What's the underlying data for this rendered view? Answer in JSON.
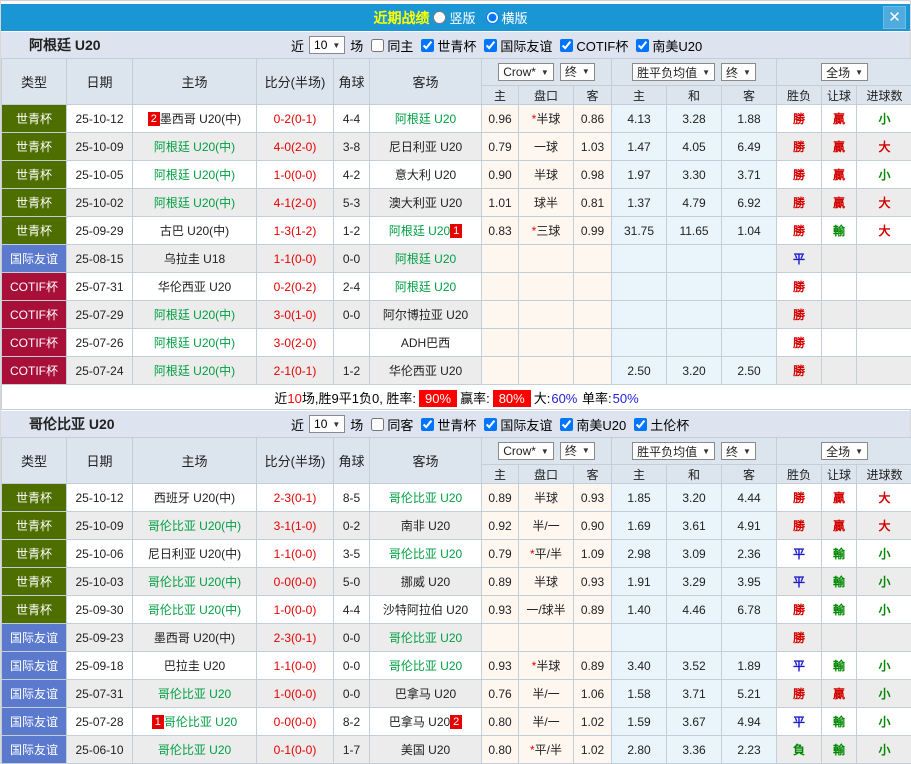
{
  "colors": {
    "titlebar_bg": "#1b96d5",
    "title_text": "#ffff00",
    "team_green": "#00a042",
    "score_red": "#e60000",
    "result_red": "#d40000",
    "result_green": "#008800",
    "result_blue": "#1a1acc",
    "pct_badge_bg": "#ff0000",
    "pct_blue": "#2222dd",
    "type_colors": {
      "世青杯": "#4e6e00",
      "国际友谊": "#5b7ace",
      "COTIF杯": "#a80f39"
    }
  },
  "titlebar": {
    "title": "近期战绩",
    "layout_options": [
      {
        "label": "竖版",
        "selected": false
      },
      {
        "label": "横版",
        "selected": true
      }
    ],
    "close_label": "✕"
  },
  "table_header": {
    "type": "类型",
    "date": "日期",
    "home": "主场",
    "score": "比分(半场)",
    "corner": "角球",
    "away": "客场",
    "odds_select": "Crow*",
    "final_select": "终",
    "avg_select": "胜平负均值",
    "final_select2": "终",
    "scope_select": "全场",
    "sub": [
      "主",
      "盘口",
      "客",
      "主",
      "和",
      "客",
      "胜负",
      "让球",
      "进球数"
    ]
  },
  "sections": [
    {
      "team": "阿根廷 U20",
      "filter": {
        "near_label": "近",
        "count": "10",
        "games_label": "场",
        "same_label": "同主",
        "same_checked": false,
        "competitions": [
          {
            "label": "世青杯",
            "checked": true
          },
          {
            "label": "国际友谊",
            "checked": true
          },
          {
            "label": "COTIF杯",
            "checked": true
          },
          {
            "label": "南美U20",
            "checked": true
          }
        ]
      },
      "rows": [
        {
          "type": "世青杯",
          "date": "25-10-12",
          "homeBadge": "2",
          "home": "墨西哥 U20(中)",
          "homeGreen": false,
          "score": "0-2(0-1)",
          "corner": "4-4",
          "away": "阿根廷 U20",
          "awayGreen": true,
          "awayBadge": "",
          "crow": [
            "0.96",
            "*半球",
            "0.86"
          ],
          "avg": [
            "4.13",
            "3.28",
            "1.88"
          ],
          "res": [
            "勝",
            "贏",
            "小"
          ]
        },
        {
          "type": "世青杯",
          "date": "25-10-09",
          "homeBadge": "",
          "home": "阿根廷 U20(中)",
          "homeGreen": true,
          "score": "4-0(2-0)",
          "corner": "3-8",
          "away": "尼日利亚 U20",
          "awayGreen": false,
          "awayBadge": "",
          "crow": [
            "0.79",
            "一球",
            "1.03"
          ],
          "avg": [
            "1.47",
            "4.05",
            "6.49"
          ],
          "res": [
            "勝",
            "贏",
            "大"
          ]
        },
        {
          "type": "世青杯",
          "date": "25-10-05",
          "homeBadge": "",
          "home": "阿根廷 U20(中)",
          "homeGreen": true,
          "score": "1-0(0-0)",
          "corner": "4-2",
          "away": "意大利 U20",
          "awayGreen": false,
          "awayBadge": "",
          "crow": [
            "0.90",
            "半球",
            "0.98"
          ],
          "avg": [
            "1.97",
            "3.30",
            "3.71"
          ],
          "res": [
            "勝",
            "贏",
            "小"
          ]
        },
        {
          "type": "世青杯",
          "date": "25-10-02",
          "homeBadge": "",
          "home": "阿根廷 U20(中)",
          "homeGreen": true,
          "score": "4-1(2-0)",
          "corner": "5-3",
          "away": "澳大利亚 U20",
          "awayGreen": false,
          "awayBadge": "",
          "crow": [
            "1.01",
            "球半",
            "0.81"
          ],
          "avg": [
            "1.37",
            "4.79",
            "6.92"
          ],
          "res": [
            "勝",
            "贏",
            "大"
          ]
        },
        {
          "type": "世青杯",
          "date": "25-09-29",
          "homeBadge": "",
          "home": "古巴 U20(中)",
          "homeGreen": false,
          "score": "1-3(1-2)",
          "corner": "1-2",
          "away": "阿根廷 U20",
          "awayGreen": true,
          "awayBadge": "1",
          "crow": [
            "0.83",
            "*三球",
            "0.99"
          ],
          "avg": [
            "31.75",
            "11.65",
            "1.04"
          ],
          "res": [
            "勝",
            "輸",
            "大"
          ]
        },
        {
          "type": "国际友谊",
          "date": "25-08-15",
          "homeBadge": "",
          "home": "乌拉圭 U18",
          "homeGreen": false,
          "score": "1-1(0-0)",
          "corner": "0-0",
          "away": "阿根廷 U20",
          "awayGreen": true,
          "awayBadge": "",
          "crow": [
            "",
            "",
            ""
          ],
          "avg": [
            "",
            "",
            ""
          ],
          "res": [
            "平",
            "",
            ""
          ]
        },
        {
          "type": "COTIF杯",
          "date": "25-07-31",
          "homeBadge": "",
          "home": "华伦西亚 U20",
          "homeGreen": false,
          "score": "0-2(0-2)",
          "corner": "2-4",
          "away": "阿根廷 U20",
          "awayGreen": true,
          "awayBadge": "",
          "crow": [
            "",
            "",
            ""
          ],
          "avg": [
            "",
            "",
            ""
          ],
          "res": [
            "勝",
            "",
            ""
          ]
        },
        {
          "type": "COTIF杯",
          "date": "25-07-29",
          "homeBadge": "",
          "home": "阿根廷 U20(中)",
          "homeGreen": true,
          "score": "3-0(1-0)",
          "corner": "0-0",
          "away": "阿尔博拉亚 U20",
          "awayGreen": false,
          "awayBadge": "",
          "crow": [
            "",
            "",
            ""
          ],
          "avg": [
            "",
            "",
            ""
          ],
          "res": [
            "勝",
            "",
            ""
          ]
        },
        {
          "type": "COTIF杯",
          "date": "25-07-26",
          "homeBadge": "",
          "home": "阿根廷 U20(中)",
          "homeGreen": true,
          "score": "3-0(2-0)",
          "corner": "",
          "away": "ADH巴西",
          "awayGreen": false,
          "awayBadge": "",
          "crow": [
            "",
            "",
            ""
          ],
          "avg": [
            "",
            "",
            ""
          ],
          "res": [
            "勝",
            "",
            ""
          ]
        },
        {
          "type": "COTIF杯",
          "date": "25-07-24",
          "homeBadge": "",
          "home": "阿根廷 U20(中)",
          "homeGreen": true,
          "score": "2-1(0-1)",
          "corner": "1-2",
          "away": "华伦西亚 U20",
          "awayGreen": false,
          "awayBadge": "",
          "crow": [
            "",
            "",
            ""
          ],
          "avg": [
            "2.50",
            "3.20",
            "2.50"
          ],
          "res": [
            "勝",
            "",
            ""
          ]
        }
      ],
      "summary": [
        {
          "t": "近",
          "s": "k"
        },
        {
          "t": "10",
          "s": "red"
        },
        {
          "t": "场,胜9平1负0, 胜率:",
          "s": "k"
        },
        {
          "t": "90%",
          "s": "redbg"
        },
        {
          "t": "赢率:",
          "s": "k"
        },
        {
          "t": "80%",
          "s": "redbg"
        },
        {
          "t": "大:",
          "s": "k"
        },
        {
          "t": "60%",
          "s": "blue"
        },
        {
          "t": " 单率:",
          "s": "k"
        },
        {
          "t": "50%",
          "s": "blue"
        }
      ]
    },
    {
      "team": "哥伦比亚 U20",
      "filter": {
        "near_label": "近",
        "count": "10",
        "games_label": "场",
        "same_label": "同客",
        "same_checked": false,
        "competitions": [
          {
            "label": "世青杯",
            "checked": true
          },
          {
            "label": "国际友谊",
            "checked": true
          },
          {
            "label": "南美U20",
            "checked": true
          },
          {
            "label": "土伦杯",
            "checked": true
          }
        ]
      },
      "rows": [
        {
          "type": "世青杯",
          "date": "25-10-12",
          "homeBadge": "",
          "home": "西班牙 U20(中)",
          "homeGreen": false,
          "score": "2-3(0-1)",
          "corner": "8-5",
          "away": "哥伦比亚 U20",
          "awayGreen": true,
          "awayBadge": "",
          "crow": [
            "0.89",
            "半球",
            "0.93"
          ],
          "avg": [
            "1.85",
            "3.20",
            "4.44"
          ],
          "res": [
            "勝",
            "贏",
            "大"
          ]
        },
        {
          "type": "世青杯",
          "date": "25-10-09",
          "homeBadge": "",
          "home": "哥伦比亚 U20(中)",
          "homeGreen": true,
          "score": "3-1(1-0)",
          "corner": "0-2",
          "away": "南非 U20",
          "awayGreen": false,
          "awayBadge": "",
          "crow": [
            "0.92",
            "半/一",
            "0.90"
          ],
          "avg": [
            "1.69",
            "3.61",
            "4.91"
          ],
          "res": [
            "勝",
            "贏",
            "大"
          ]
        },
        {
          "type": "世青杯",
          "date": "25-10-06",
          "homeBadge": "",
          "home": "尼日利亚 U20(中)",
          "homeGreen": false,
          "score": "1-1(0-0)",
          "corner": "3-5",
          "away": "哥伦比亚 U20",
          "awayGreen": true,
          "awayBadge": "",
          "crow": [
            "0.79",
            "*平/半",
            "1.09"
          ],
          "avg": [
            "2.98",
            "3.09",
            "2.36"
          ],
          "res": [
            "平",
            "輸",
            "小"
          ]
        },
        {
          "type": "世青杯",
          "date": "25-10-03",
          "homeBadge": "",
          "home": "哥伦比亚 U20(中)",
          "homeGreen": true,
          "score": "0-0(0-0)",
          "corner": "5-0",
          "away": "挪威 U20",
          "awayGreen": false,
          "awayBadge": "",
          "crow": [
            "0.89",
            "半球",
            "0.93"
          ],
          "avg": [
            "1.91",
            "3.29",
            "3.95"
          ],
          "res": [
            "平",
            "輸",
            "小"
          ]
        },
        {
          "type": "世青杯",
          "date": "25-09-30",
          "homeBadge": "",
          "home": "哥伦比亚 U20(中)",
          "homeGreen": true,
          "score": "1-0(0-0)",
          "corner": "4-4",
          "away": "沙特阿拉伯 U20",
          "awayGreen": false,
          "awayBadge": "",
          "crow": [
            "0.93",
            "一/球半",
            "0.89"
          ],
          "avg": [
            "1.40",
            "4.46",
            "6.78"
          ],
          "res": [
            "勝",
            "輸",
            "小"
          ]
        },
        {
          "type": "国际友谊",
          "date": "25-09-23",
          "homeBadge": "",
          "home": "墨西哥 U20(中)",
          "homeGreen": false,
          "score": "2-3(0-1)",
          "corner": "0-0",
          "away": "哥伦比亚 U20",
          "awayGreen": true,
          "awayBadge": "",
          "crow": [
            "",
            "",
            ""
          ],
          "avg": [
            "",
            "",
            ""
          ],
          "res": [
            "勝",
            "",
            ""
          ]
        },
        {
          "type": "国际友谊",
          "date": "25-09-18",
          "homeBadge": "",
          "home": "巴拉圭 U20",
          "homeGreen": false,
          "score": "1-1(0-0)",
          "corner": "0-0",
          "away": "哥伦比亚 U20",
          "awayGreen": true,
          "awayBadge": "",
          "crow": [
            "0.93",
            "*半球",
            "0.89"
          ],
          "avg": [
            "3.40",
            "3.52",
            "1.89"
          ],
          "res": [
            "平",
            "輸",
            "小"
          ]
        },
        {
          "type": "国际友谊",
          "date": "25-07-31",
          "homeBadge": "",
          "home": "哥伦比亚 U20",
          "homeGreen": true,
          "score": "1-0(0-0)",
          "corner": "0-0",
          "away": "巴拿马 U20",
          "awayGreen": false,
          "awayBadge": "",
          "crow": [
            "0.76",
            "半/一",
            "1.06"
          ],
          "avg": [
            "1.58",
            "3.71",
            "5.21"
          ],
          "res": [
            "勝",
            "贏",
            "小"
          ]
        },
        {
          "type": "国际友谊",
          "date": "25-07-28",
          "homeBadge": "1",
          "home": "哥伦比亚 U20",
          "homeGreen": true,
          "score": "0-0(0-0)",
          "corner": "8-2",
          "away": "巴拿马 U20",
          "awayGreen": false,
          "awayBadge": "2",
          "crow": [
            "0.80",
            "半/一",
            "1.02"
          ],
          "avg": [
            "1.59",
            "3.67",
            "4.94"
          ],
          "res": [
            "平",
            "輸",
            "小"
          ]
        },
        {
          "type": "国际友谊",
          "date": "25-06-10",
          "homeBadge": "",
          "home": "哥伦比亚 U20",
          "homeGreen": true,
          "score": "0-1(0-0)",
          "corner": "1-7",
          "away": "美国 U20",
          "awayGreen": false,
          "awayBadge": "",
          "crow": [
            "0.80",
            "*平/半",
            "1.02"
          ],
          "avg": [
            "2.80",
            "3.36",
            "2.23"
          ],
          "res": [
            "負",
            "輸",
            "小"
          ]
        }
      ],
      "summary": null
    }
  ]
}
